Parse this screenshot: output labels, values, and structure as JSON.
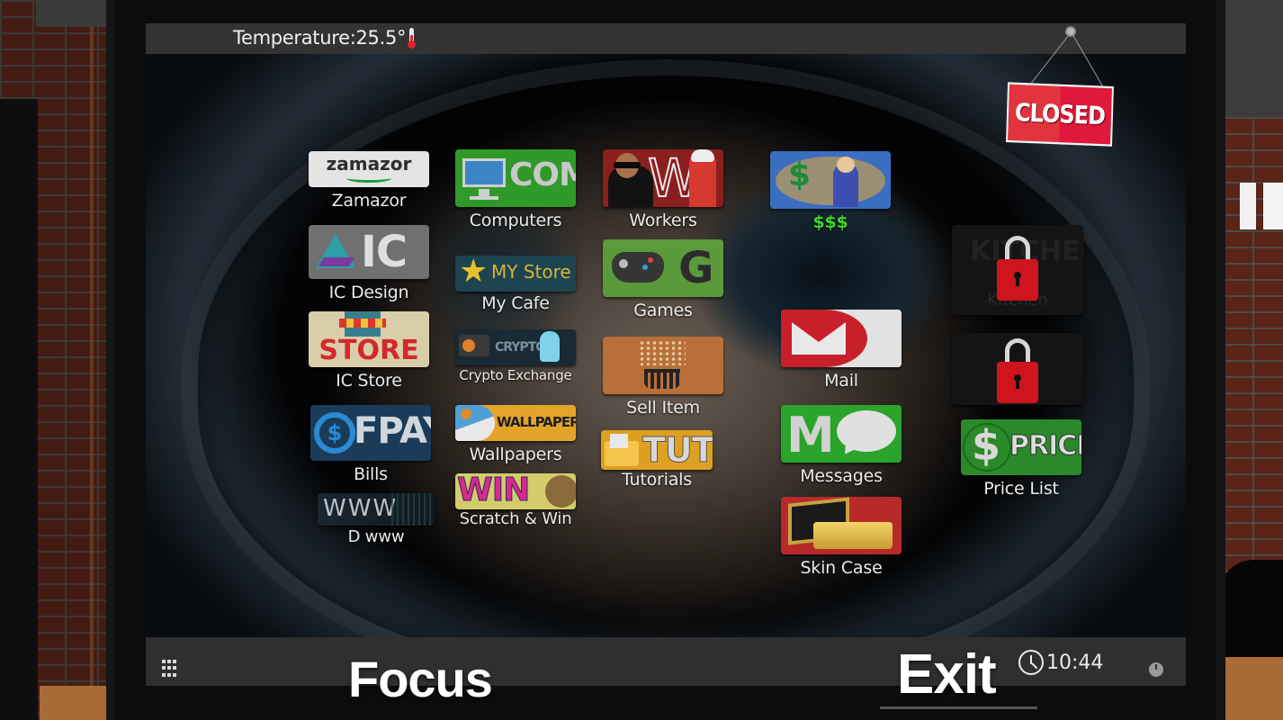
{
  "status_bar": {
    "temperature_label": "Temperature:",
    "temperature_value": "25.5°",
    "temperature_icon": "thermometer-icon"
  },
  "closed_sign": {
    "text": "CLOSED"
  },
  "apps": {
    "zamazor": {
      "logo_text": "zamazor",
      "label": "Zamazor"
    },
    "computers": {
      "logo_text": "COM",
      "label": "Computers"
    },
    "workers": {
      "logo_text": "W",
      "label": "Workers"
    },
    "money": {
      "logo_text": "$",
      "label": "$$$"
    },
    "ic_design": {
      "logo_text": "IC",
      "label": "IC Design"
    },
    "my_cafe": {
      "logo_text": "MY Store",
      "label": "My Cafe"
    },
    "games": {
      "logo_text": "G",
      "label": "Games"
    },
    "ic_store": {
      "logo_text": "STORE",
      "label": "IC Store"
    },
    "crypto": {
      "logo_text": "CRYPTO",
      "label": "Crypto Exchange"
    },
    "sell_item": {
      "label": "Sell Item"
    },
    "mail": {
      "label": "Mail"
    },
    "bills": {
      "logo_text": "FPAY",
      "coin_text": "$",
      "label": "Bills"
    },
    "wallpapers": {
      "logo_text": "WALLPAPERS",
      "label": "Wallpapers"
    },
    "tutorials": {
      "logo_text": "TUT",
      "label": "Tutorials"
    },
    "messages": {
      "logo_text": "M",
      "label": "Messages"
    },
    "d_www": {
      "logo_text": "WWW",
      "label": "D www"
    },
    "scratch_win": {
      "logo_text": "WIN",
      "label": "Scratch & Win"
    },
    "skin_case": {
      "label": "Skin Case"
    },
    "kitchen": {
      "logo_text": "KITCHEN",
      "label": "Kitchen",
      "locked": true
    },
    "locked_app": {
      "locked": true
    },
    "price_list": {
      "logo_text": "PRICE",
      "coin_text": "$",
      "label": "Price List"
    }
  },
  "taskbar": {
    "start_icon": "grid-icon",
    "time": "10:44",
    "clock_icon": "clock-icon",
    "power_icon": "power-icon"
  },
  "game_controls": {
    "focus_label": "Focus",
    "exit_label": "Exit"
  },
  "colors": {
    "taskbar_bg": "#2f2f2f",
    "topbar_bg": "#333333",
    "lock_red": "#d0141e",
    "money_label_green": "#46d32e",
    "closed_sign_red": "#e2343e"
  }
}
